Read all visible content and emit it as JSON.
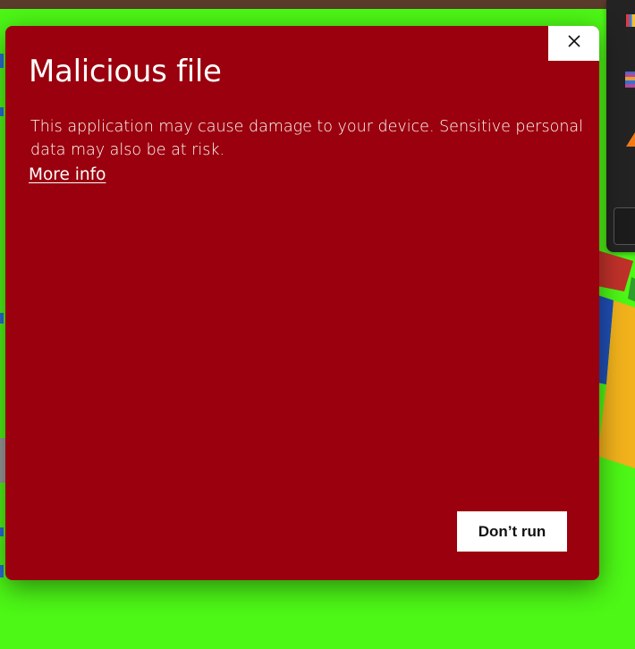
{
  "dialog": {
    "title": "Malicious file",
    "message": "This application may cause damage to your device. Sensitive personal data may also be at risk.",
    "more_info_label": "More info",
    "dont_run_label": "Don’t run",
    "close_icon": "close-icon"
  },
  "colors": {
    "dialog_background": "#9a000d",
    "desktop_background": "#4df716",
    "button_background": "#ffffff",
    "text": "#ffffff"
  }
}
